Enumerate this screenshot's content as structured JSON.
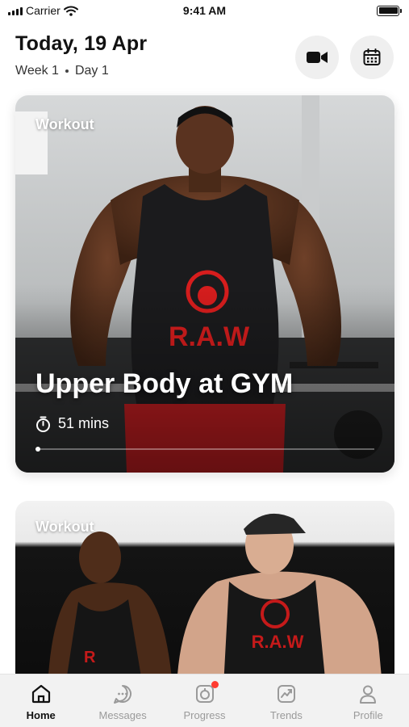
{
  "status_bar": {
    "carrier": "Carrier",
    "time": "9:41 AM",
    "battery_level": 1.0
  },
  "header": {
    "date": "Today, 19 Apr",
    "week": "Week 1",
    "day": "Day 1",
    "video_icon": "video-camera-icon",
    "calendar_icon": "calendar-icon"
  },
  "cards": [
    {
      "tag": "Workout",
      "title": "Upper Body at GYM",
      "duration": "51 mins",
      "timer_icon": "stopwatch-icon",
      "progress": 0.0
    },
    {
      "tag": "Workout"
    }
  ],
  "tab_bar": {
    "active": "Home",
    "items": [
      {
        "label": "Home",
        "icon": "home-icon"
      },
      {
        "label": "Messages",
        "icon": "chat-icon"
      },
      {
        "label": "Progress",
        "icon": "progress-icon",
        "badge": true
      },
      {
        "label": "Trends",
        "icon": "trend-chart-icon"
      },
      {
        "label": "Profile",
        "icon": "user-icon"
      }
    ]
  },
  "colors": {
    "badge": "#ff3b30",
    "active_tab": "#111111",
    "inactive_tab": "#9a9a9a",
    "shirt_print": "#d71d1d"
  }
}
